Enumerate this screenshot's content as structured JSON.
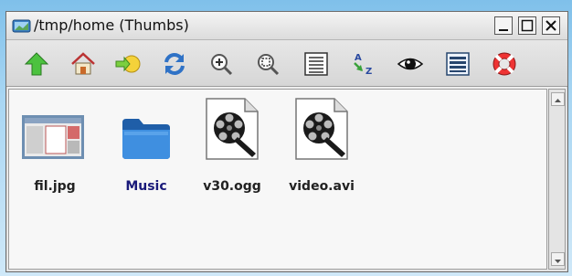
{
  "window": {
    "title": "/tmp/home (Thumbs)"
  },
  "titlebar_buttons": [
    "minimize-icon",
    "maximize-icon",
    "close-icon"
  ],
  "toolbar": {
    "buttons": [
      {
        "name": "up-button",
        "icon": "up-arrow-icon"
      },
      {
        "name": "home-button",
        "icon": "home-icon"
      },
      {
        "name": "go-button",
        "icon": "go-icon"
      },
      {
        "name": "refresh-button",
        "icon": "refresh-icon"
      },
      {
        "name": "zoom-in-button",
        "icon": "zoom-in-icon"
      },
      {
        "name": "zoom-fit-button",
        "icon": "zoom-fit-icon"
      },
      {
        "name": "details-view-button",
        "icon": "details-view-icon"
      },
      {
        "name": "sort-button",
        "icon": "sort-az-icon"
      },
      {
        "name": "show-hidden-button",
        "icon": "eye-icon"
      },
      {
        "name": "list-view-button",
        "icon": "list-view-icon"
      },
      {
        "name": "help-button",
        "icon": "lifebuoy-icon"
      }
    ]
  },
  "files": [
    {
      "label": "fil.jpg",
      "type": "image"
    },
    {
      "label": "Music",
      "type": "folder"
    },
    {
      "label": "v30.ogg",
      "type": "video"
    },
    {
      "label": "video.avi",
      "type": "video"
    }
  ],
  "colors": {
    "folder_label": "#1a1a7a",
    "file_label": "#222222",
    "folder_blue": "#2f7fd0"
  }
}
